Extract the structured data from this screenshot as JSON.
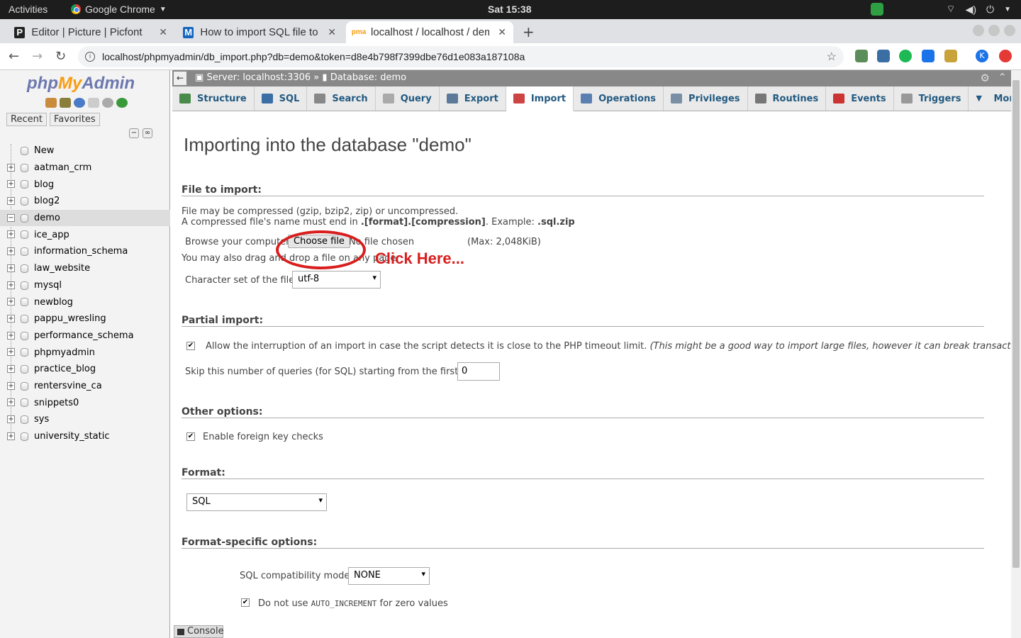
{
  "system": {
    "activities": "Activities",
    "app_name": "Google Chrome",
    "clock": "Sat 15:38"
  },
  "tabs": [
    {
      "title": "Editor | Picture | Picfont",
      "active": false
    },
    {
      "title": "How to import SQL file to",
      "active": false
    },
    {
      "title": "localhost / localhost / demo",
      "active": true
    }
  ],
  "address": {
    "url": "localhost/phpmyadmin/db_import.php?db=demo&token=d8e4b798f7399dbe76d1e083a187108a"
  },
  "pma": {
    "logo": {
      "php": "php",
      "my": "My",
      "admin": "Admin"
    },
    "recent": "Recent",
    "favorites": "Favorites",
    "new_label": "New",
    "databases": [
      "aatman_crm",
      "blog",
      "blog2",
      "demo",
      "ice_app",
      "information_schema",
      "law_website",
      "mysql",
      "newblog",
      "pappu_wresling",
      "performance_schema",
      "phpmyadmin",
      "practice_blog",
      "rentersvine_ca",
      "snippets0",
      "sys",
      "university_static"
    ],
    "active_db": "demo"
  },
  "breadcrumb": {
    "server": "Server: localhost:3306 »",
    "database": "Database: demo"
  },
  "menu": [
    "Structure",
    "SQL",
    "Search",
    "Query",
    "Export",
    "Import",
    "Operations",
    "Privileges",
    "Routines",
    "Events",
    "Triggers",
    "More"
  ],
  "menu_active": "Import",
  "import": {
    "title": "Importing into the database \"demo\"",
    "file_section": "File to import:",
    "compress_note": "File may be compressed (gzip, bzip2, zip) or uncompressed.",
    "compress_note2_a": "A compressed file's name must end in ",
    "compress_note2_b": ".[format].[compression]",
    "compress_note2_c": ". Example: ",
    "compress_note2_d": ".sql.zip",
    "browse_label": "Browse your computer:",
    "choose_file": "Choose file",
    "no_file": "No file chosen",
    "max_size": "(Max: 2,048KiB)",
    "drag_note": "You may also drag and drop a file on any page.",
    "annotation": "Click Here...",
    "charset_label": "Character set of the file:",
    "charset_value": "utf-8",
    "partial_section": "Partial import:",
    "allow_interrupt": "Allow the interruption of an import in case the script detects it is close to the PHP timeout limit.",
    "allow_interrupt_note": "(This might be a good way to import large files, however it can break transactions.)",
    "skip_label": "Skip this number of queries (for SQL) starting from the first one:",
    "skip_value": "0",
    "other_section": "Other options:",
    "fk_checks": "Enable foreign key checks",
    "format_section": "Format:",
    "format_value": "SQL",
    "format_specific_section": "Format-specific options:",
    "compat_label": "SQL compatibility mode:",
    "compat_value": "NONE",
    "auto_inc_a": "Do not use ",
    "auto_inc_b": "AUTO_INCREMENT",
    "auto_inc_c": " for zero values"
  },
  "console": "Console",
  "colors": {
    "accent": "#235a81",
    "annotation": "#d81e1e"
  }
}
